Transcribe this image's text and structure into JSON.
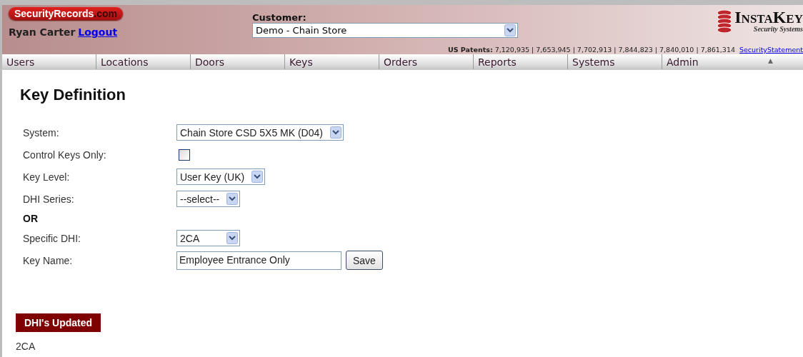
{
  "header": {
    "brand": {
      "name": "SecurityRecords",
      "suffix": ".com"
    },
    "user": "Ryan Carter",
    "logout": "Logout",
    "customer": {
      "label": "Customer:",
      "value": "Demo - Chain Store"
    },
    "patents": {
      "label": "US Patents:",
      "numbers": "7,120,935 | 7,653,945 | 7,702,913 | 7,844,823 | 7,840,010 | 7,861,314"
    },
    "security_link": "SecurityStatement",
    "logo": {
      "name": "InstaKey",
      "tagline": "Security Systems"
    }
  },
  "nav": {
    "items": [
      {
        "label": "Users"
      },
      {
        "label": "Locations"
      },
      {
        "label": "Doors"
      },
      {
        "label": "Keys"
      },
      {
        "label": "Orders"
      },
      {
        "label": "Reports"
      },
      {
        "label": "Systems"
      },
      {
        "label": "Admin"
      }
    ],
    "scroll_glyph": "▲"
  },
  "page": {
    "title": "Key Definition",
    "fields": [
      {
        "kind": "select",
        "label": "System:",
        "value": "Chain Store CSD 5X5 MK (D04)"
      },
      {
        "kind": "checkbox",
        "label": "Control Keys Only:",
        "checked": false
      },
      {
        "kind": "select",
        "label": "Key Level:",
        "value": "User Key (UK)"
      },
      {
        "kind": "select",
        "label": "DHI Series:",
        "value": "--select--"
      },
      {
        "kind": "heading",
        "label": "OR"
      },
      {
        "kind": "select",
        "label": "Specific DHI:",
        "value": "2CA"
      },
      {
        "kind": "input",
        "label": "Key Name:",
        "value": "Employee Entrance Only",
        "button": "Save"
      }
    ],
    "updated": {
      "title": "DHI's Updated",
      "items": [
        "2CA"
      ]
    }
  }
}
